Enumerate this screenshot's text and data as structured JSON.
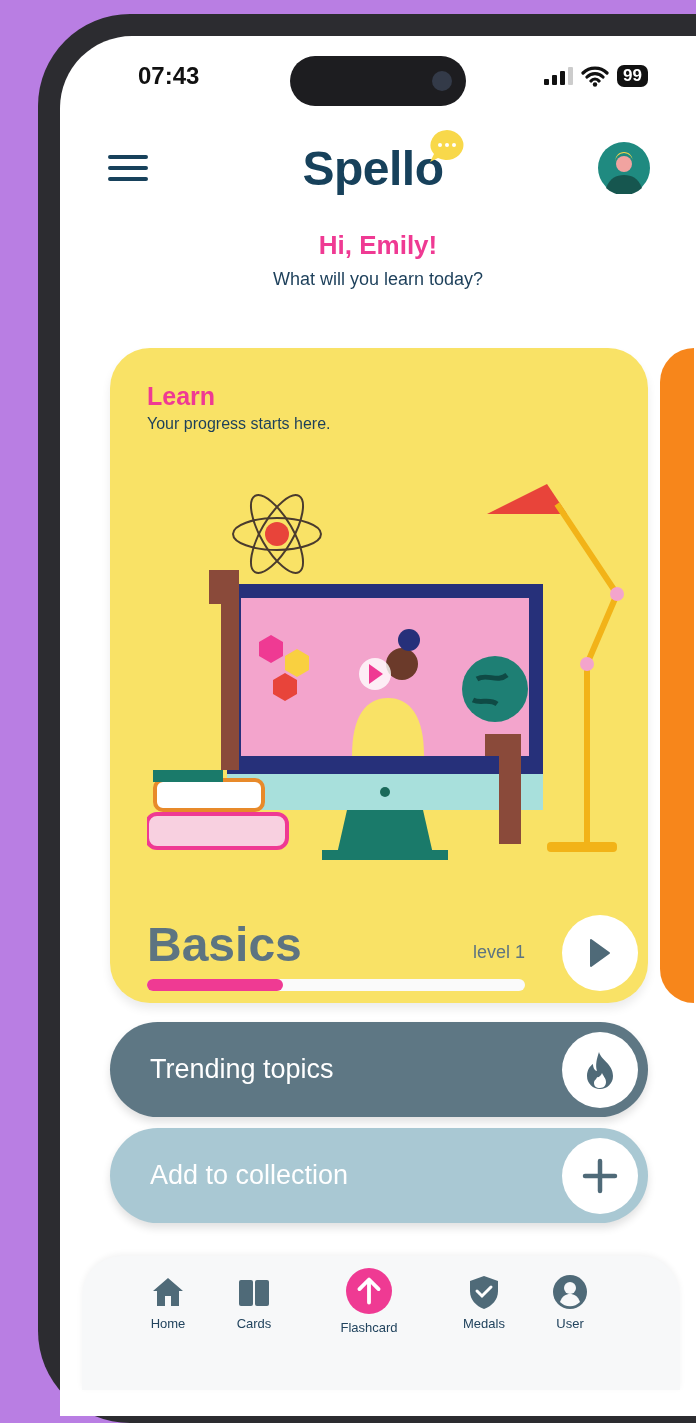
{
  "status_bar": {
    "time": "07:43",
    "battery": "99"
  },
  "header": {
    "logo": "Spello"
  },
  "greeting": {
    "title": "Hi, Emily!",
    "subtitle": "What will you learn today?"
  },
  "cards": [
    {
      "kind": "learn",
      "color": "#f9e266",
      "title": "Learn",
      "subtitle": "Your progress starts here.",
      "course": "Basics",
      "level_label": "level 1",
      "level": 0.36
    },
    {
      "kind": "peek",
      "color": "#f7861b"
    }
  ],
  "actions": [
    {
      "kind": "trending",
      "label": "Trending topics"
    },
    {
      "kind": "add",
      "label": "Add to collection"
    }
  ],
  "nav": [
    {
      "kind": "home",
      "label": "Home"
    },
    {
      "kind": "cards",
      "label": "Cards"
    },
    {
      "kind": "flashcard",
      "label": "Flashcard"
    },
    {
      "kind": "medals",
      "label": "Medals"
    },
    {
      "kind": "user",
      "label": "User"
    }
  ]
}
